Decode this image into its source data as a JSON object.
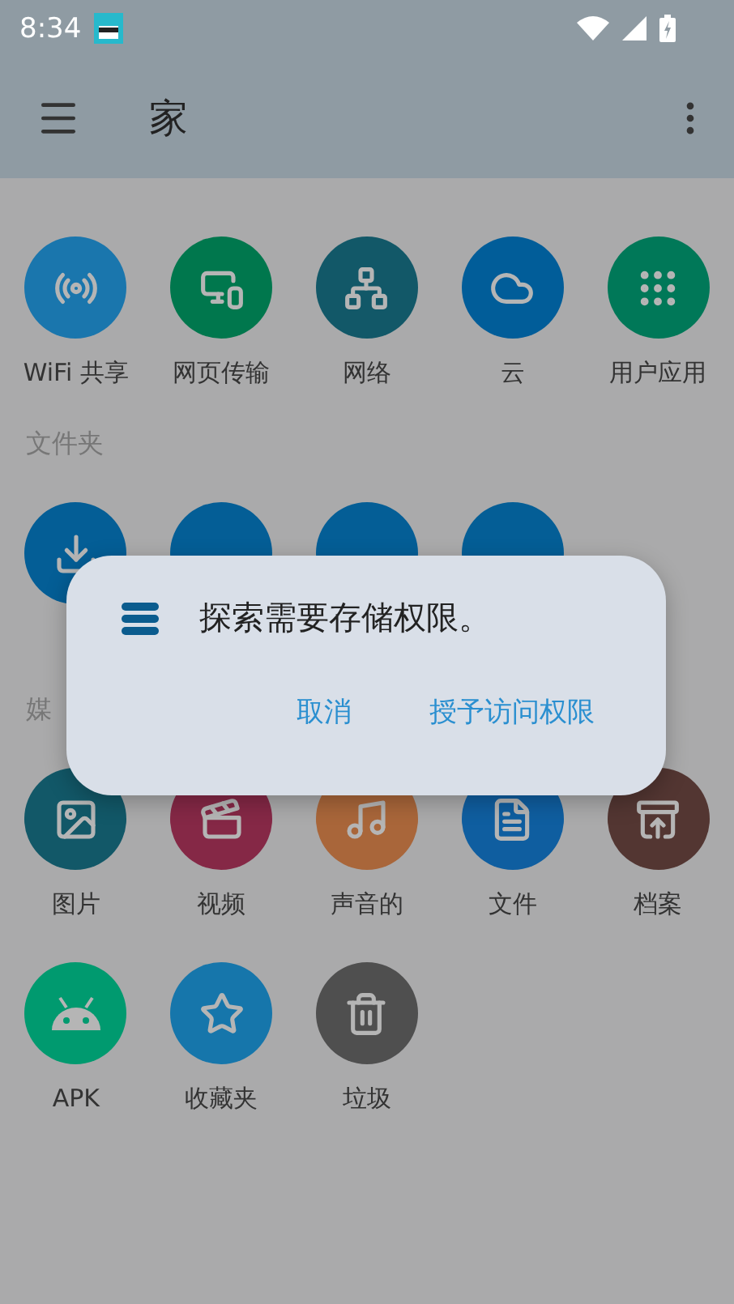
{
  "status_bar": {
    "time": "8:34"
  },
  "app_bar": {
    "title": "家"
  },
  "sections": [
    {
      "items": [
        {
          "label": "WiFi 共享",
          "color": "#1a76ad"
        },
        {
          "label": "网页传输",
          "color": "#00774d"
        },
        {
          "label": "网络",
          "color": "#125868"
        },
        {
          "label": "云",
          "color": "#015d99"
        },
        {
          "label": "用户应用",
          "color": "#007858"
        }
      ]
    },
    {
      "heading": "文件夹",
      "items": [
        {
          "color": "#045e96"
        },
        {
          "color": "#045e96"
        },
        {
          "color": "#045e96"
        },
        {
          "color": "#045e96"
        }
      ]
    },
    {
      "heading": "媒",
      "items": [
        {
          "label": "图片",
          "color": "#125868"
        },
        {
          "label": "视频",
          "color": "#852846"
        },
        {
          "label": "声音的",
          "color": "#a9663a"
        },
        {
          "label": "文件",
          "color": "#0f5ea0"
        },
        {
          "label": "档案",
          "color": "#533632"
        },
        {
          "label": "APK",
          "color": "#009a6f"
        },
        {
          "label": "收藏夹",
          "color": "#1676ab"
        },
        {
          "label": "垃圾",
          "color": "#4f4f4f"
        }
      ]
    }
  ],
  "dialog": {
    "title": "探索需要存储权限。",
    "buttons": [
      "取消",
      "授予访问权限"
    ]
  }
}
